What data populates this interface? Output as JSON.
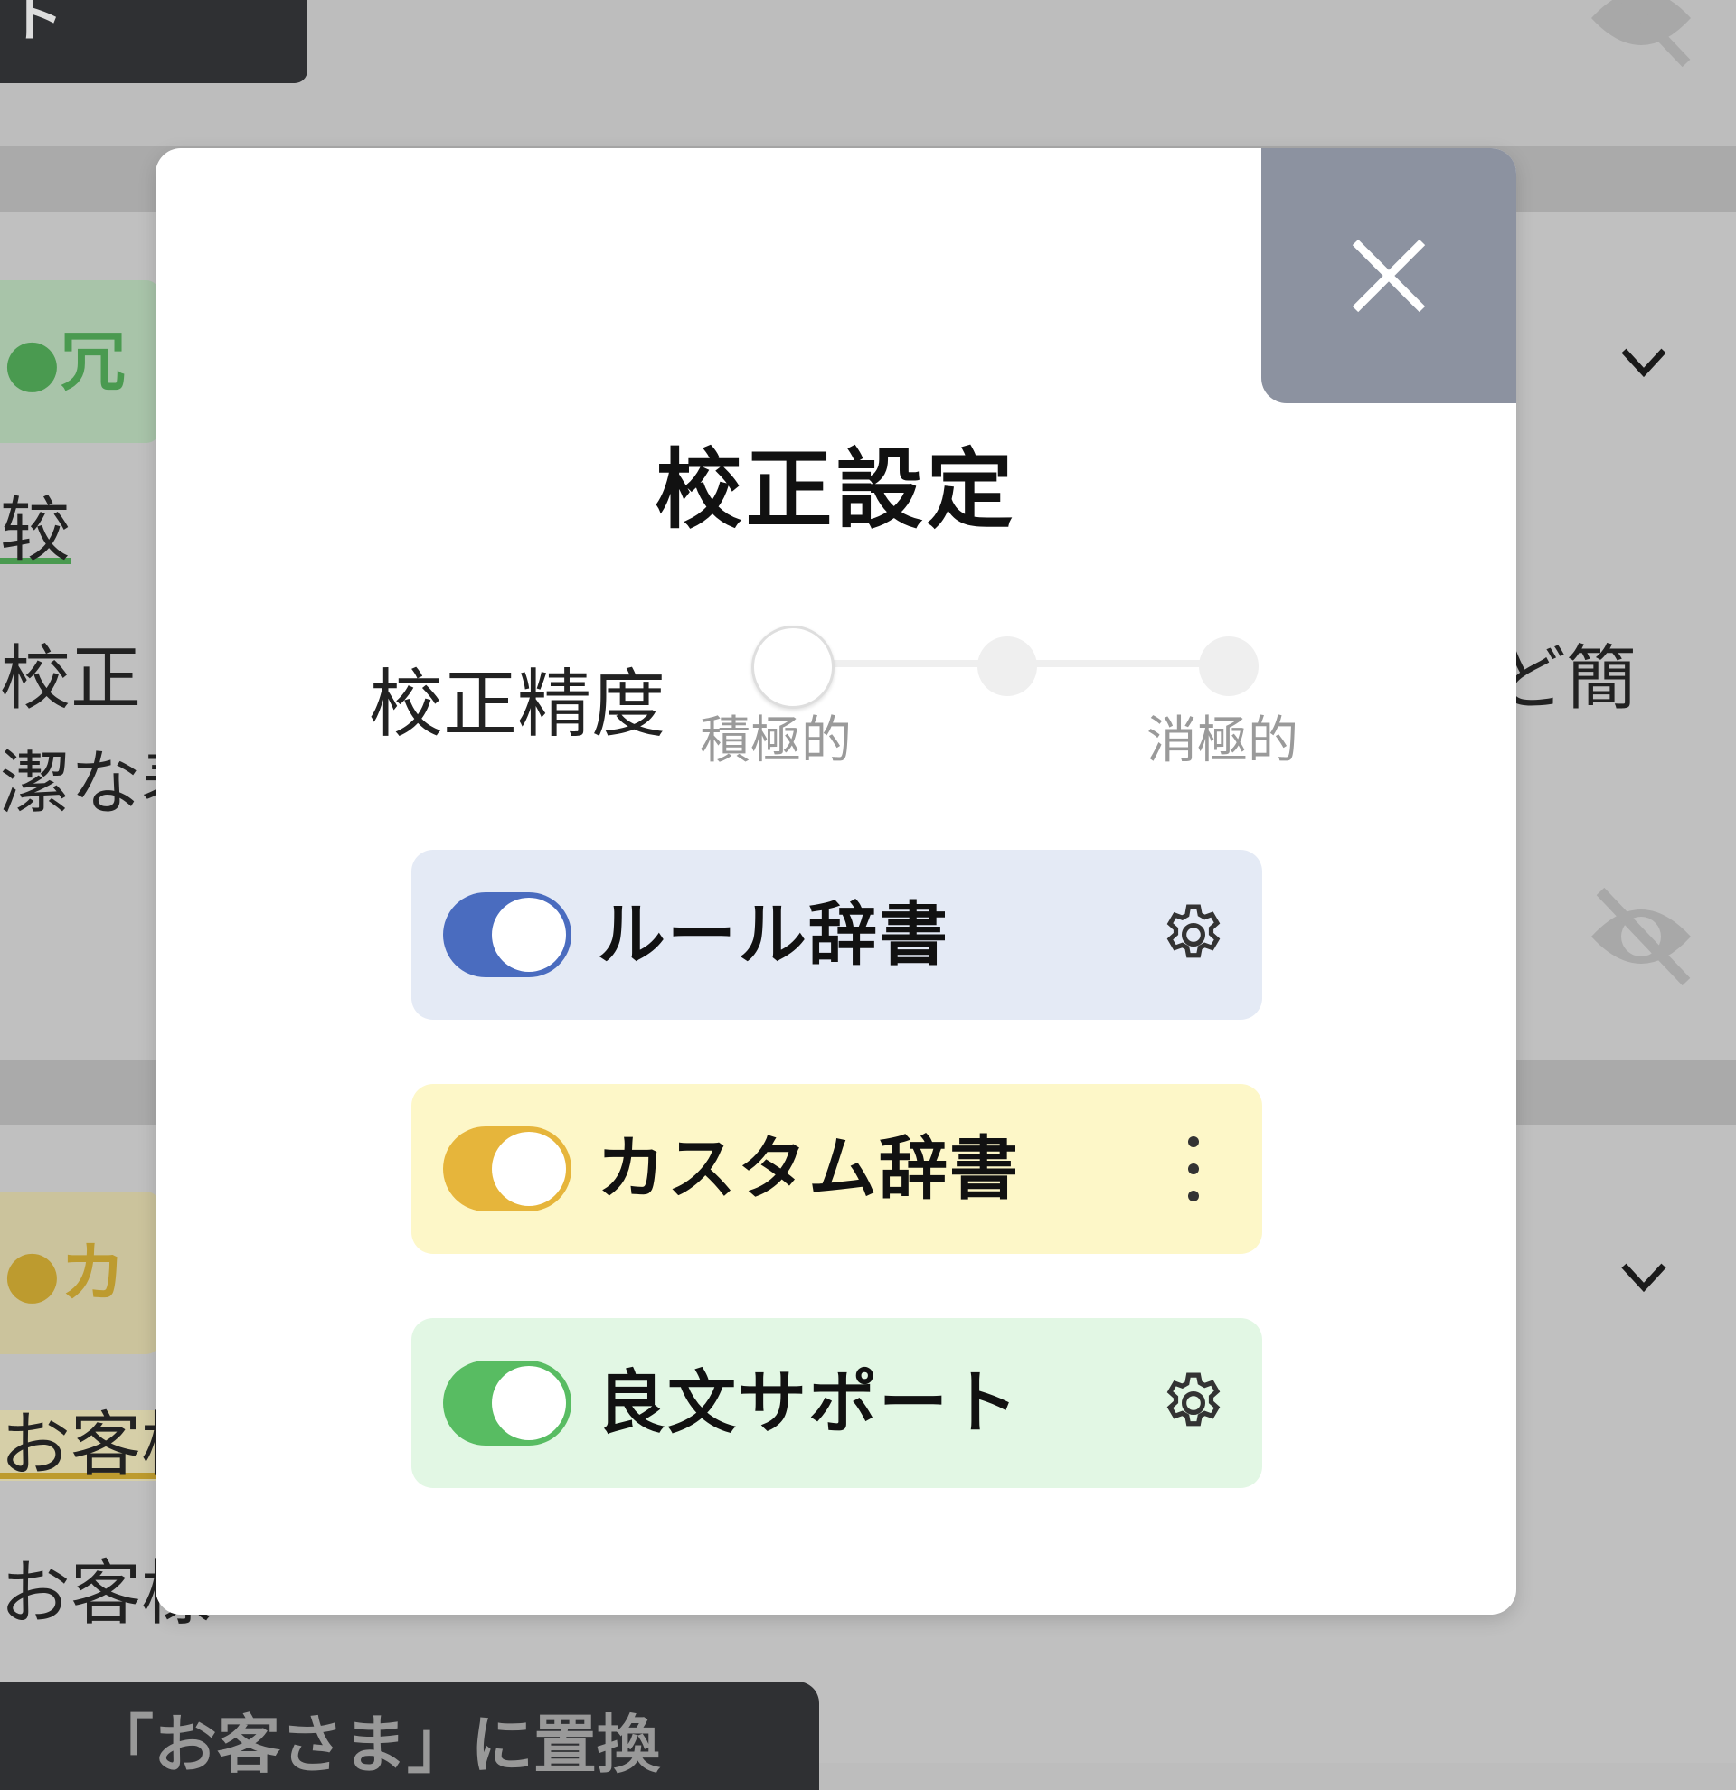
{
  "background": {
    "top_button_label": "ト",
    "section1_tag": "●冗長",
    "section1_underlined": "较",
    "section1_line1": "校正",
    "section1_line1_right": "ど簡",
    "section1_line2": "潔な表",
    "section2_tag": "●カス",
    "section2_line1": "お客様",
    "section2_line2": "お客様",
    "bottom_button_label": "「お客さま」に置換"
  },
  "modal": {
    "title": "校正設定",
    "precision": {
      "label": "校正精度",
      "min_label": "積極的",
      "max_label": "消極的",
      "level_count": 3,
      "selected_index": 0
    },
    "dictionaries": [
      {
        "label": "ルール辞書",
        "enabled": true,
        "color": "#4a6cbf",
        "action_icon": "gear-icon"
      },
      {
        "label": "カスタム辞書",
        "enabled": true,
        "color": "#e6b53b",
        "action_icon": "more-vertical-icon"
      },
      {
        "label": "良文サポート",
        "enabled": true,
        "color": "#58bc62",
        "action_icon": "gear-icon"
      }
    ]
  }
}
